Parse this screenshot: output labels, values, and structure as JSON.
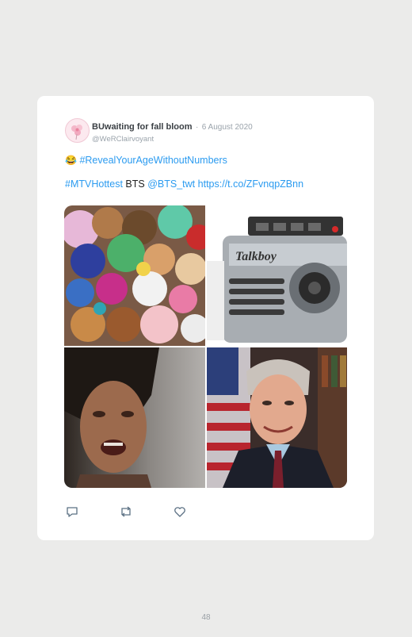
{
  "tweet": {
    "display_name": "BUwaiting for fall bloom",
    "separator": "·",
    "date": "6 August 2020",
    "handle": "@WeRClairvoyant",
    "line1": {
      "emoji": "😂",
      "hashtag": "#RevealYourAgeWithoutNumbers"
    },
    "line2": {
      "hashtag": "#MTVHottest",
      "text": "BTS",
      "mention": "@BTS_twt",
      "url": "https://t.co/ZFvnqpZBnn"
    },
    "images": {
      "talkboy_label": "Talkboy"
    },
    "actions": [
      "reply-icon",
      "retweet-icon",
      "like-icon"
    ]
  },
  "colors": {
    "link": "#2b9bf0",
    "background": "#ebebea",
    "card": "#ffffff"
  },
  "page": {
    "number": "48"
  }
}
